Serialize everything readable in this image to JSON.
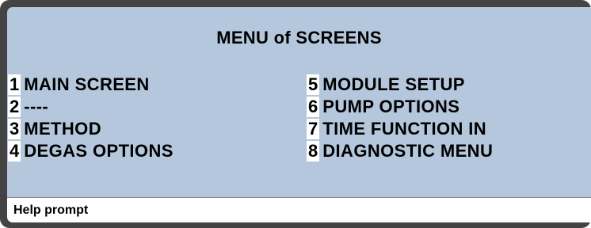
{
  "screen": {
    "title": "MENU of SCREENS",
    "left_items": [
      {
        "key": "1",
        "label": "MAIN SCREEN"
      },
      {
        "key": "2",
        "label": "----"
      },
      {
        "key": "3",
        "label": "METHOD"
      },
      {
        "key": "4",
        "label": "DEGAS OPTIONS"
      }
    ],
    "right_items": [
      {
        "key": "5",
        "label": "MODULE SETUP"
      },
      {
        "key": "6",
        "label": "PUMP OPTIONS"
      },
      {
        "key": "7",
        "label": "TIME FUNCTION IN"
      },
      {
        "key": "8",
        "label": "DIAGNOSTIC MENU"
      }
    ],
    "help_prompt": "Help prompt"
  },
  "colors": {
    "screen_background": "#b4c7dc",
    "bezel": "#434343",
    "key_highlight": "#ffffff",
    "help_bar": "#ffffff",
    "text": "#000000"
  }
}
